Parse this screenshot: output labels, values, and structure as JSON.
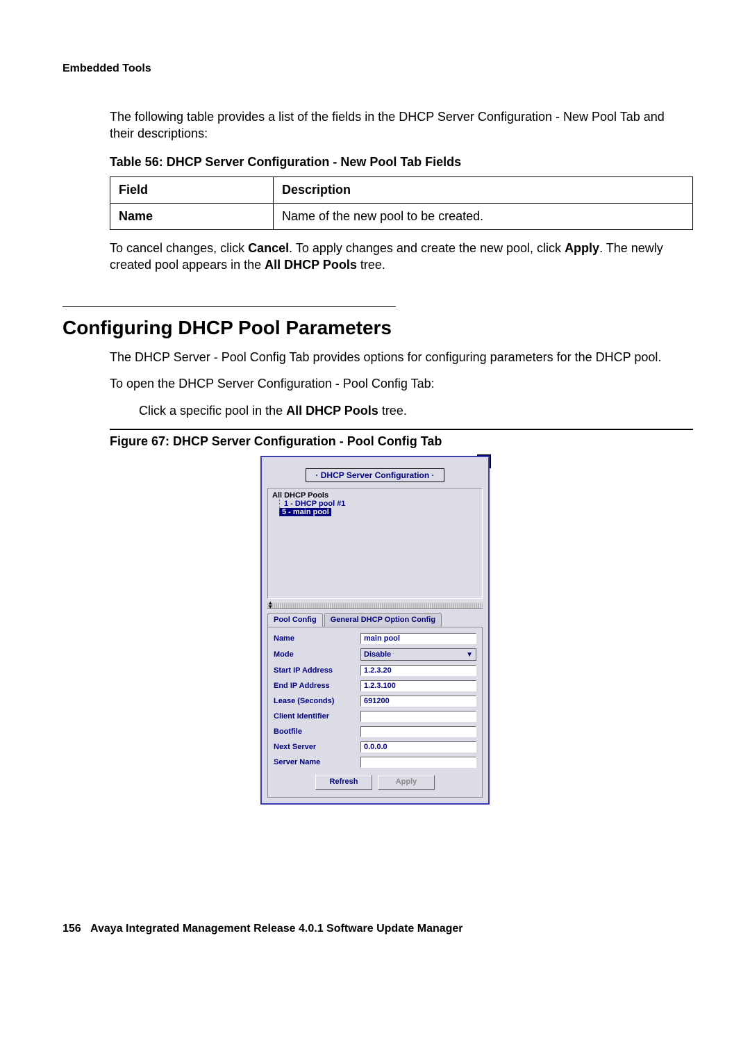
{
  "header": {
    "section": "Embedded Tools"
  },
  "intro": {
    "p1": "The following table provides a list of the fields in the DHCP Server Configuration - New Pool Tab and their descriptions:"
  },
  "table56": {
    "caption": "Table 56: DHCP Server Configuration - New Pool Tab Fields",
    "head_field": "Field",
    "head_desc": "Description",
    "row1_field": "Name",
    "row1_desc": "Name of the new pool to be created."
  },
  "posttable": {
    "prefix": "To cancel changes, click ",
    "cancel": "Cancel",
    "mid1": ". To apply changes and create the new pool, click ",
    "apply": "Apply",
    "mid2": ". The newly created pool appears in the ",
    "alltree": "All DHCP Pools",
    "suffix": " tree."
  },
  "section2": {
    "title": "Configuring DHCP Pool Parameters",
    "p1": "The DHCP Server - Pool Config Tab provides options for configuring parameters for the DHCP pool.",
    "p2": "To open the DHCP Server Configuration - Pool Config Tab:",
    "step_prefix": "Click a specific pool in the ",
    "step_bold": "All DHCP Pools",
    "step_suffix": " tree."
  },
  "figure67": {
    "caption": "Figure 67: DHCP Server Configuration - Pool Config Tab"
  },
  "applet": {
    "close_glyph": "⊠",
    "title": "· DHCP Server Configuration ·",
    "tree": {
      "root": "All DHCP Pools",
      "item1": "1 - DHCP pool #1",
      "item2": "5 - main pool"
    },
    "tabs": {
      "active": "Pool Config",
      "other": "General DHCP Option Config"
    },
    "form": {
      "name_label": "Name",
      "name_value": "main pool",
      "mode_label": "Mode",
      "mode_value": "Disable",
      "start_label": "Start IP Address",
      "start_value": "1.2.3.20",
      "end_label": "End IP Address",
      "end_value": "1.2.3.100",
      "lease_label": "Lease (Seconds)",
      "lease_value": "691200",
      "client_label": "Client Identifier",
      "client_value": "",
      "bootfile_label": "Bootfile",
      "bootfile_value": "",
      "next_label": "Next Server",
      "next_value": "0.0.0.0",
      "server_label": "Server Name",
      "server_value": ""
    },
    "buttons": {
      "refresh": "Refresh",
      "apply": "Apply"
    }
  },
  "footer": {
    "page": "156",
    "title": "Avaya Integrated Management Release 4.0.1 Software Update Manager"
  }
}
